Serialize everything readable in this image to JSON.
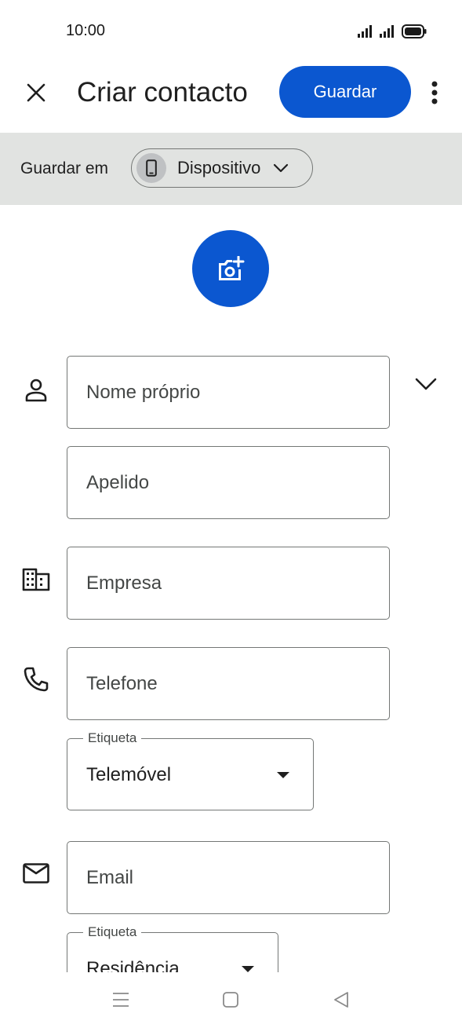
{
  "status_bar": {
    "time": "10:00"
  },
  "header": {
    "title": "Criar contacto",
    "save_label": "Guardar"
  },
  "save_to": {
    "label": "Guardar em",
    "account": "Dispositivo"
  },
  "form": {
    "first_name": {
      "placeholder": "Nome próprio"
    },
    "last_name": {
      "placeholder": "Apelido"
    },
    "company": {
      "placeholder": "Empresa"
    },
    "phone": {
      "placeholder": "Telefone",
      "label_legend": "Etiqueta",
      "label_value": "Telemóvel"
    },
    "email": {
      "placeholder": "Email",
      "label_legend": "Etiqueta",
      "label_value": "Residência"
    }
  },
  "colors": {
    "accent": "#0b57d0",
    "bar_bg": "#e1e3e1",
    "outline": "#747775"
  },
  "icons": [
    "close-icon",
    "more-vert-icon",
    "phone-device-icon",
    "chevron-down-icon",
    "add-photo-icon",
    "person-icon",
    "business-icon",
    "phone-icon",
    "email-icon",
    "menu-icon",
    "home-icon",
    "back-icon"
  ]
}
